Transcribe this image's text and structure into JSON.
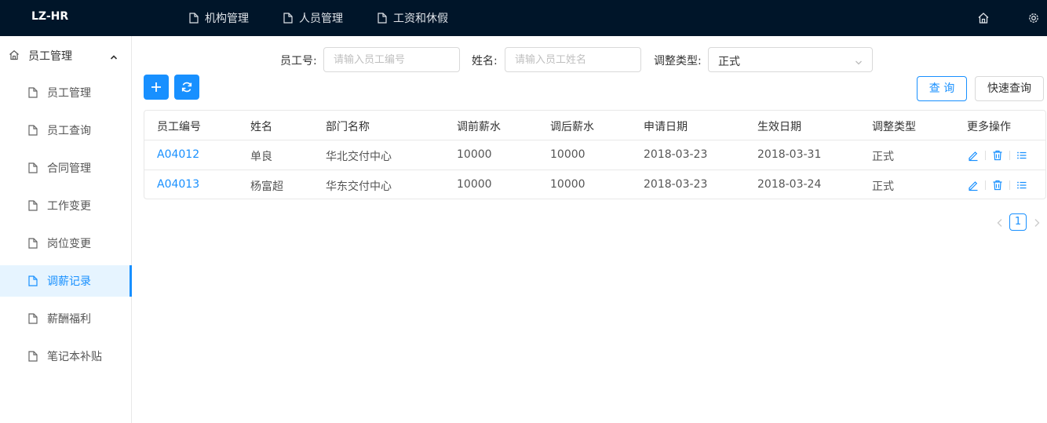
{
  "app": {
    "brand": "LZ-HR"
  },
  "topnav": [
    {
      "label": "机构管理"
    },
    {
      "label": "人员管理"
    },
    {
      "label": "工资和休假"
    }
  ],
  "sidebar": {
    "group_label": "员工管理",
    "items": [
      {
        "label": "员工管理"
      },
      {
        "label": "员工查询"
      },
      {
        "label": "合同管理"
      },
      {
        "label": "工作变更"
      },
      {
        "label": "岗位变更"
      },
      {
        "label": "调薪记录",
        "active": true
      },
      {
        "label": "薪酬福利"
      },
      {
        "label": "笔记本补贴"
      }
    ]
  },
  "search": {
    "emp_no_label": "员工号:",
    "emp_no_placeholder": "请输入员工编号",
    "name_label": "姓名:",
    "name_placeholder": "请输入员工姓名",
    "type_label": "调整类型:",
    "type_value": "正式",
    "query_label": "查 询",
    "quick_query_label": "快速查询"
  },
  "table": {
    "columns": [
      "员工编号",
      "姓名",
      "部门名称",
      "调前薪水",
      "调后薪水",
      "申请日期",
      "生效日期",
      "调整类型",
      "更多操作"
    ],
    "rows": [
      [
        "A04012",
        "单良",
        "华北交付中心",
        "10000",
        "10000",
        "2018-03-23",
        "2018-03-31",
        "正式"
      ],
      [
        "A04013",
        "杨富超",
        "华东交付中心",
        "10000",
        "10000",
        "2018-03-23",
        "2018-03-24",
        "正式"
      ]
    ]
  },
  "pagination": {
    "current": "1"
  },
  "colors": {
    "accent": "#1890ff",
    "topbar": "#001529"
  },
  "icons": [
    "document-icon",
    "home-icon",
    "settings-icon",
    "chevron-up-icon",
    "chevron-down-icon",
    "plus-icon",
    "refresh-icon",
    "edit-icon",
    "delete-icon",
    "list-icon",
    "prev-page-icon",
    "next-page-icon"
  ]
}
